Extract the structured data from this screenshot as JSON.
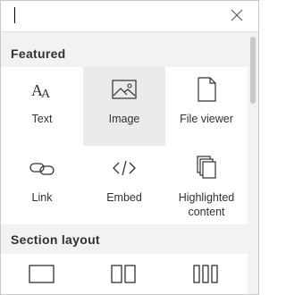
{
  "search": {
    "value": "",
    "placeholder": ""
  },
  "close_icon": "close-icon",
  "sections": {
    "featured": {
      "title": "Featured",
      "items": [
        {
          "label": "Text",
          "icon": "text-icon"
        },
        {
          "label": "Image",
          "icon": "image-icon",
          "selected": true
        },
        {
          "label": "File viewer",
          "icon": "file-viewer-icon"
        },
        {
          "label": "Link",
          "icon": "link-icon"
        },
        {
          "label": "Embed",
          "icon": "embed-icon"
        },
        {
          "label": "Highlighted content",
          "icon": "highlighted-content-icon"
        }
      ]
    },
    "section_layout": {
      "title": "Section layout",
      "items": [
        {
          "icon": "one-column-icon"
        },
        {
          "icon": "two-columns-icon"
        },
        {
          "icon": "three-columns-icon"
        }
      ]
    }
  },
  "colors": {
    "text": "#323130",
    "icon": "#323130",
    "selected_bg": "#edebe9",
    "panel_bg": "#f3f2f1"
  }
}
